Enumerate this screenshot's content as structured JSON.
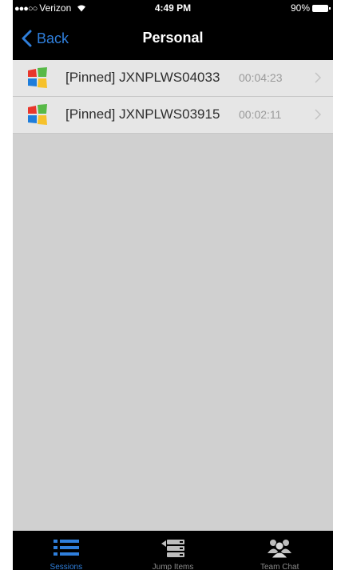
{
  "status_bar": {
    "signal": "●●●○○",
    "carrier": "Verizon",
    "wifi_icon": "wifi-icon",
    "time": "4:49 PM",
    "battery": "90%"
  },
  "nav": {
    "back_label": "Back",
    "title": "Personal"
  },
  "sessions": [
    {
      "name": "[Pinned] JXNPLWS04033",
      "duration": "00:04:23",
      "icon": "windows-logo-icon"
    },
    {
      "name": "[Pinned] JXNPLWS03915",
      "duration": "00:02:11",
      "icon": "windows-logo-icon"
    }
  ],
  "tabs": [
    {
      "label": "Sessions",
      "icon": "list-icon",
      "active": true
    },
    {
      "label": "Jump Items",
      "icon": "jump-items-icon",
      "active": false
    },
    {
      "label": "Team Chat",
      "icon": "team-icon",
      "active": false
    }
  ],
  "colors": {
    "accent": "#2f7fdc",
    "background": "#d0d0d0",
    "row": "#e6e6e6",
    "bar": "#000000"
  }
}
